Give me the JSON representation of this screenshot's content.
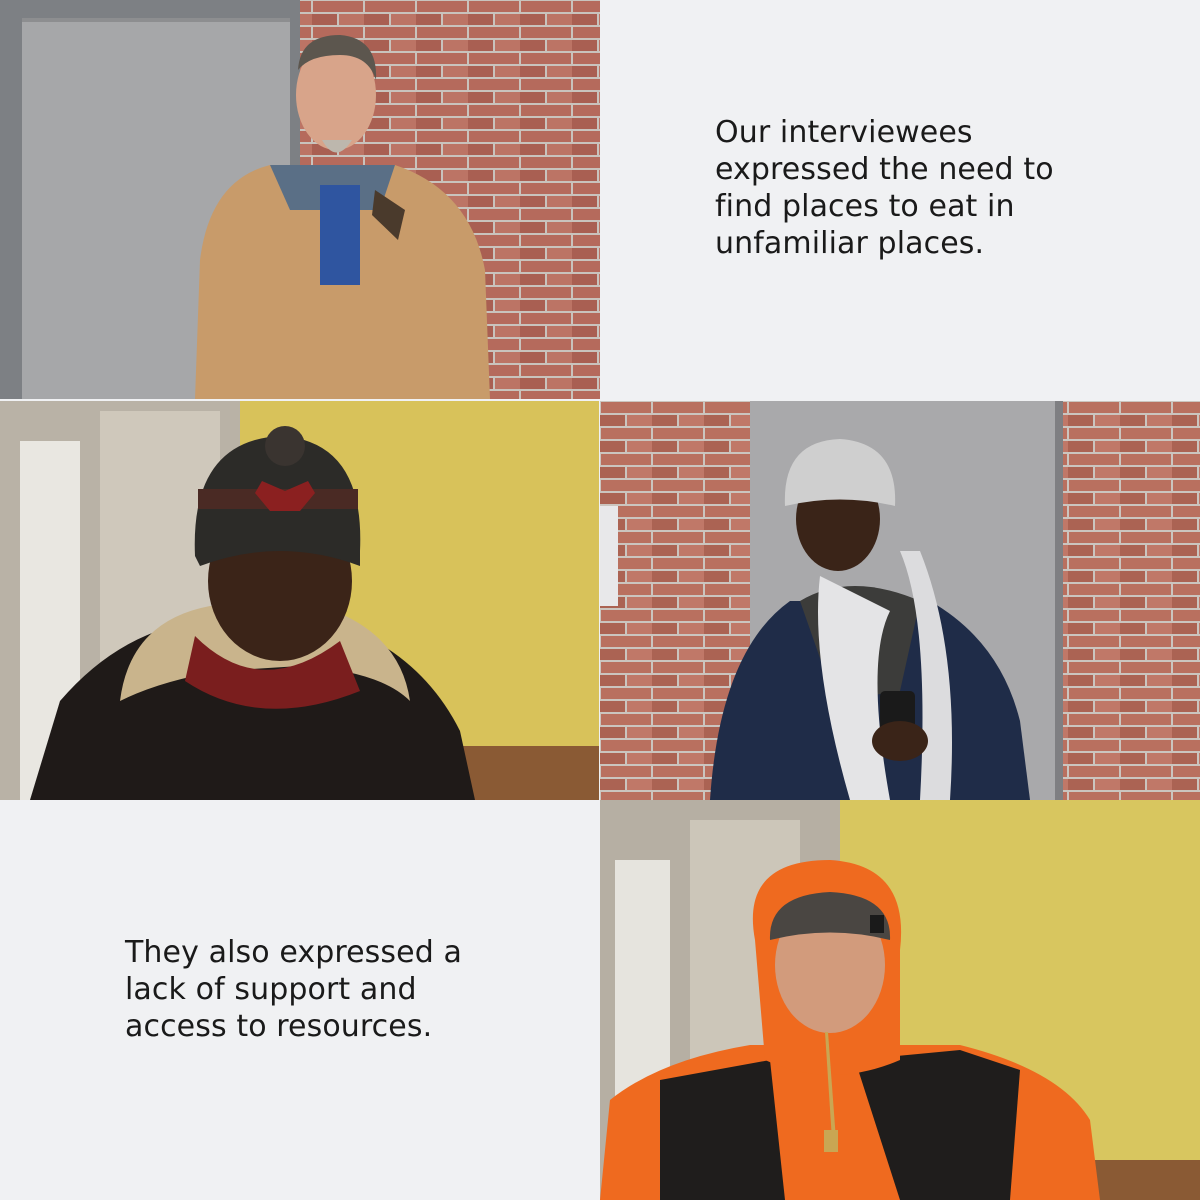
{
  "captions": {
    "top": "Our interviewees\nexpressed the need to\nfind places to eat in\nunfamiliar places.",
    "bottom": "They also expressed a\nlack of support and\naccess to resources."
  },
  "photos": [
    {
      "subject": "man in tan work jacket by brick wall"
    },
    {
      "subject": "man in Bulls beanie and fleece-collar jacket"
    },
    {
      "subject": "man in grey beanie and white scarf holding flip phone"
    },
    {
      "subject": "young man in orange hooded jacket"
    }
  ],
  "colors": {
    "background": "#f0f1f3",
    "brick": "#b56a5c",
    "yellow_wall": "#d9c35a"
  }
}
